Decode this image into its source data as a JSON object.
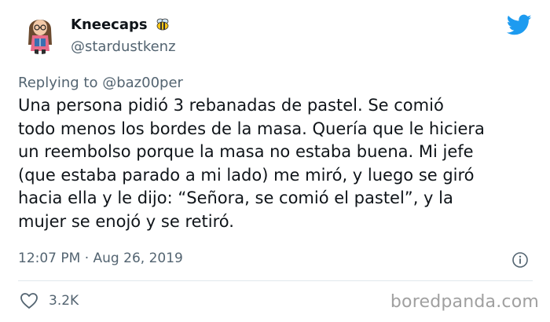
{
  "user": {
    "display_name": "Kneecaps",
    "handle": "@stardustkenz",
    "name_emoji": "bee-icon",
    "avatar": "cartoon-avatar-holding-book"
  },
  "reply": {
    "prefix": "Replying to",
    "handle": "@baz00per"
  },
  "tweet": {
    "lines": [
      "Una persona pidió 3 rebanadas de pastel. Se comió",
      "todo menos los bordes de la masa. Quería que le hiciera",
      "un reembolso porque la masa no estaba buena. Mi jefe",
      "(que estaba parado a mi lado) me miró, y luego se giró",
      "hacia ella y le dijo: “Señora, se comió el pastel”, y la",
      "mujer se enojó y se retiró."
    ]
  },
  "meta": {
    "timestamp": "12:07 PM · Aug 26, 2019"
  },
  "actions": {
    "like_count": "3.2K"
  },
  "watermark": "boredpanda.com",
  "colors": {
    "twitter_blue": "#1d9bf0",
    "text_primary": "#0f1419",
    "text_secondary": "#536471",
    "divider": "#e1e8ed"
  }
}
